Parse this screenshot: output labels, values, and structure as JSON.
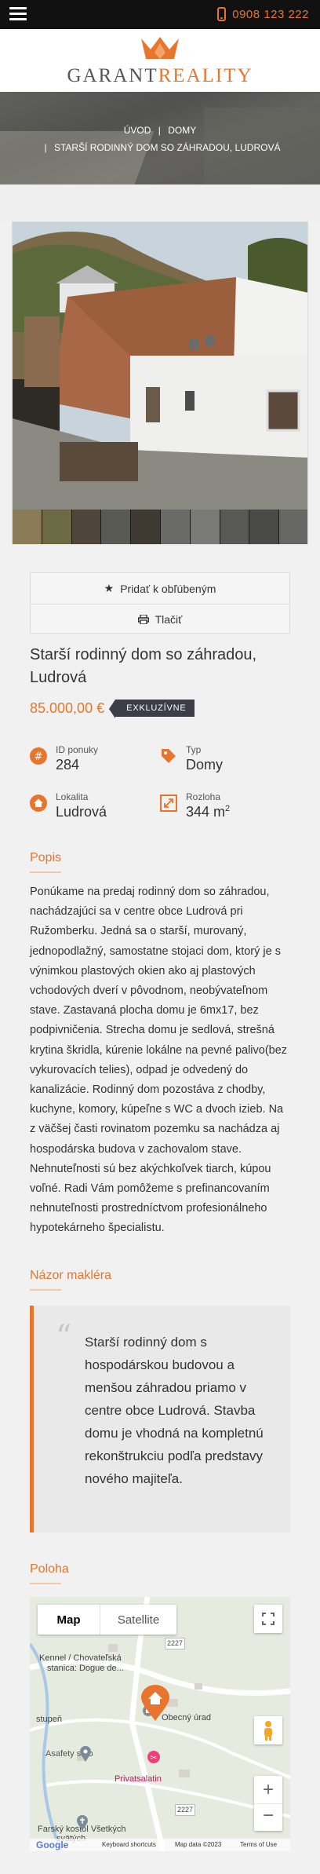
{
  "topbar": {
    "phone": "0908 123 222"
  },
  "logo": {
    "part1": "GARANT",
    "part2": "REALITY"
  },
  "breadcrumb": {
    "items": [
      "ÚVOD",
      "DOMY"
    ],
    "current": "STARŠÍ RODINNÝ DOM SO ZÁHRADOU, LUDROVÁ"
  },
  "actions": {
    "favorite": "Pridať k obľúbeným",
    "print": "Tlačiť"
  },
  "listing": {
    "title": "Starší rodinný dom so záhradou, Ludrová",
    "price": "85.000,00 €",
    "badge": "EXKLUZÍVNE"
  },
  "facts": [
    {
      "label": "ID ponuky",
      "value": "284",
      "icon": "hash-icon"
    },
    {
      "label": "Typ",
      "value": "Domy",
      "icon": "tag-icon"
    },
    {
      "label": "Lokalita",
      "value": "Ludrová",
      "icon": "home-icon"
    },
    {
      "label": "Rozloha",
      "value": "344 m",
      "unit_sup": "2",
      "icon": "expand-icon"
    }
  ],
  "sections": {
    "description": "Popis",
    "broker": "Názor makléra",
    "location": "Poloha"
  },
  "description": "Ponúkame na predaj rodinný dom so záhradou, nachádzajúci sa v centre obce Ludrová pri Ružomberku. Jedná sa o starší, murovaný, jednopodlažný, samostatne stojaci dom, ktorý je s výnimkou plastových okien ako aj plastových vchodových dverí v pôvodnom, neobývateľnom stave. Zastavaná plocha domu je 6mx17, bez podpivničenia. Strecha domu je sedlová, strešná krytina škridla, kúrenie lokálne na pevné palivo(bez vykurovacích telies), odpad je odvedený do kanalizácie. Rodinný dom pozostáva z chodby, kuchyne, komory, kúpeľne s WC a dvoch izieb. Na z väčšej časti rovinatom pozemku sa nachádza aj hospodárska budova v zachovalom stave. Nehnuteľnosti sú bez akýchkoľvek tiarch, kúpou voľné. Radi Vám pomôžeme s prefinancovaním nehnuteľnosti prostredníctvom profesionálneho hypotekárneho špecialistu.",
  "broker_quote": "Starší rodinný dom s hospodárskou budovou a menšou záhradou priamo v centre obce Ludrová. Stavba domu je vhodná na kompletnú rekonštrukciu podľa predstavy nového majiteľa.",
  "map": {
    "tab_map": "Map",
    "tab_satellite": "Satellite",
    "labels": {
      "road1": "2227",
      "road2": "2227",
      "kennel": "Kennel / Chovateľská",
      "kennel2": "stanica: Dogue de...",
      "office": "Obecný úrad",
      "stupen": "stupeň",
      "asafety": "Asafety s.r.o",
      "salon": "Privatsalatin",
      "church": "Farský kostol Všetkých",
      "church2": "svätých"
    },
    "footer": {
      "google": "Google",
      "shortcuts": "Keyboard shortcuts",
      "data": "Map data ©2023",
      "terms": "Terms of Use"
    }
  },
  "colors": {
    "accent": "#e8752e",
    "dark": "#111111",
    "badge": "#3b3e47"
  }
}
